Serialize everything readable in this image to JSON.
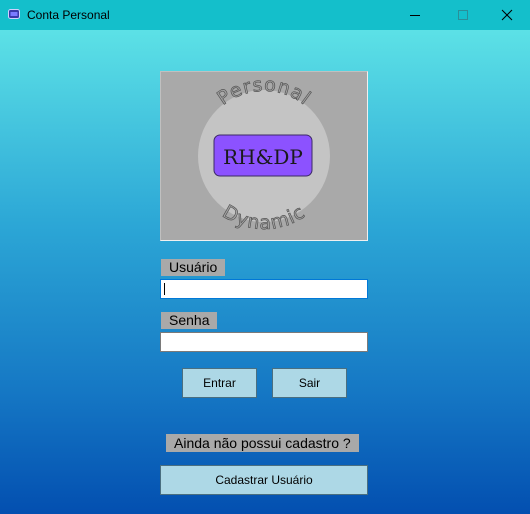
{
  "window": {
    "title": "Conta Personal",
    "minimize_icon": "minimize-icon",
    "maximize_icon": "maximize-icon",
    "close_icon": "close-icon"
  },
  "logo": {
    "top_text": "Personal",
    "center_text": "RH&DP",
    "bottom_text": "Dynamic",
    "badge_color": "#8c52ff",
    "frame_color": "#a9a9a9"
  },
  "login": {
    "user_label": "Usuário",
    "user_value": "",
    "password_label": "Senha",
    "password_value": "",
    "enter_button": "Entrar",
    "exit_button": "Sair"
  },
  "register": {
    "prompt": "Ainda não possui cadastro ?",
    "button": "Cadastrar Usuário"
  },
  "colors": {
    "titlebar": "#14bfcb",
    "gradient_top": "#5ce1e6",
    "gradient_bottom": "#034fb0",
    "button_bg": "#add8e6"
  }
}
